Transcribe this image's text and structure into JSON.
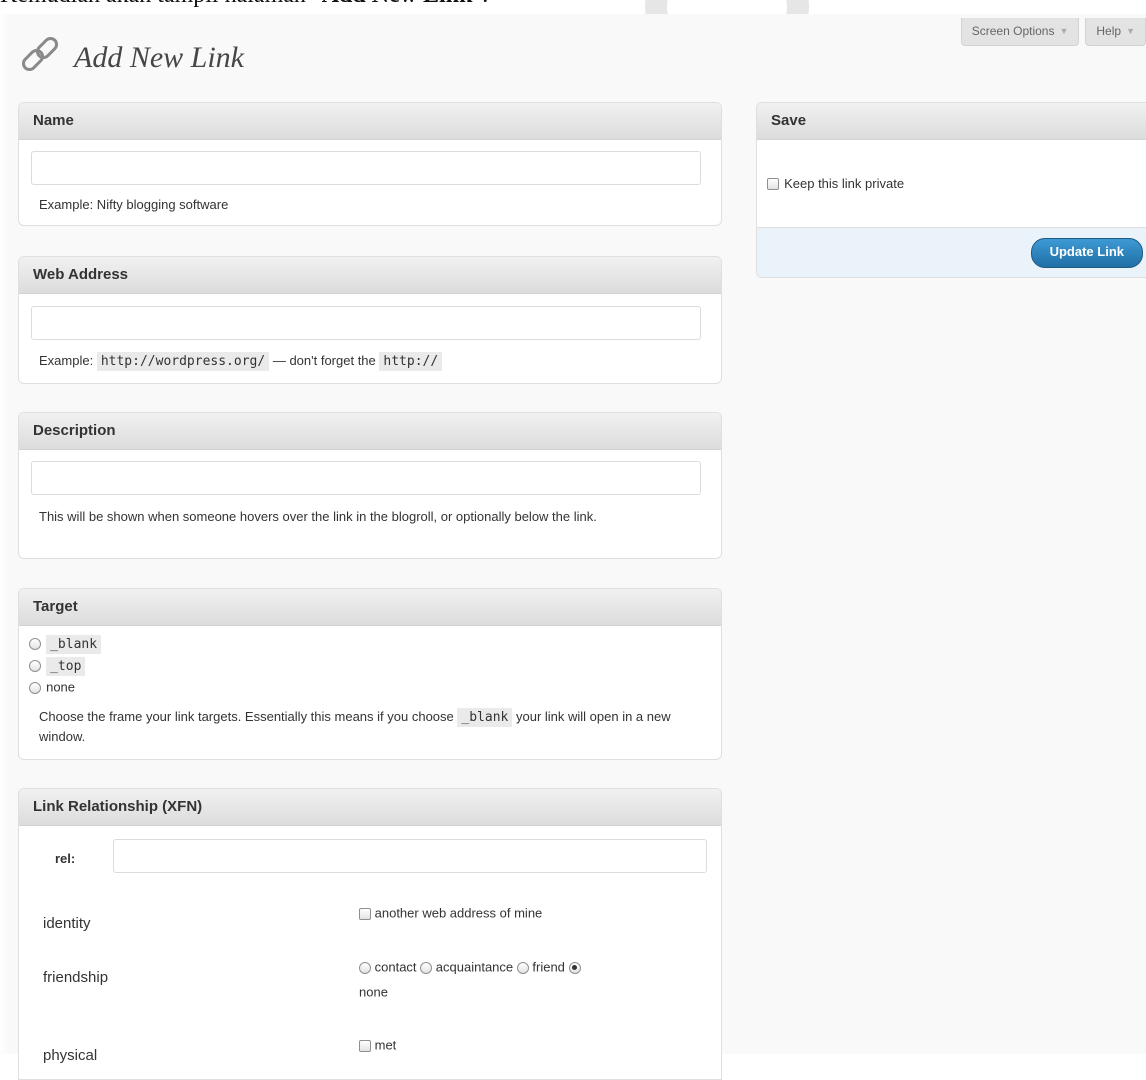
{
  "doc": {
    "prefix": "Kemudian akan tampil halaman",
    "quoted_bold": "Add New Link",
    "suffix": "\"."
  },
  "header": {
    "title": "Add New Link",
    "screen_options": "Screen Options",
    "help": "Help"
  },
  "boxes": {
    "name": {
      "title": "Name",
      "value": "",
      "hint": "Example: Nifty blogging software"
    },
    "web_address": {
      "title": "Web Address",
      "value": "",
      "hint_prefix": "Example:",
      "hint_code1": "http://wordpress.org/",
      "hint_middle": "— don't forget the",
      "hint_code2": "http://"
    },
    "description": {
      "title": "Description",
      "value": "",
      "hint": "This will be shown when someone hovers over the link in the blogroll, or optionally below the link."
    },
    "target": {
      "title": "Target",
      "options": [
        "_blank",
        "_top",
        "none"
      ],
      "hint_prefix": "Choose the frame your link targets. Essentially this means if you choose",
      "hint_code": "_blank",
      "hint_suffix": "your link will open in a new window."
    },
    "xfn": {
      "title": "Link Relationship (XFN)",
      "rel_label": "rel:",
      "rel_value": "",
      "rows": {
        "identity": {
          "label": "identity",
          "option": "another web address of mine"
        },
        "friendship": {
          "label": "friendship",
          "options": [
            "contact",
            "acquaintance",
            "friend",
            "none"
          ],
          "selected": "none"
        },
        "physical": {
          "label": "physical",
          "option": "met"
        }
      }
    }
  },
  "save": {
    "title": "Save",
    "private_label": "Keep this link private",
    "button": "Update Link"
  },
  "colors": {
    "primary_button": "#2a7fbf",
    "box_header": "#dfdfdf",
    "save_footer": "#eaf2fa"
  }
}
